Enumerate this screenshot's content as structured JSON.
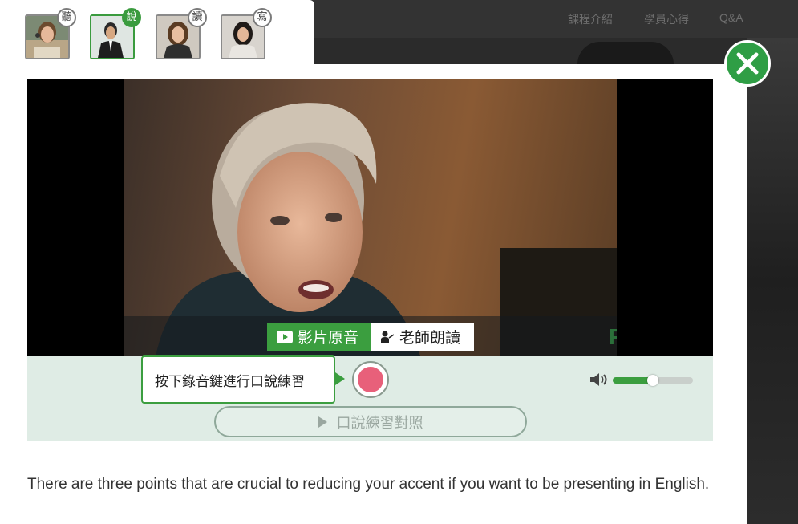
{
  "background_nav": {
    "items": [
      "課程介紹",
      "學員心得",
      "Q&A"
    ]
  },
  "skill_tabs": [
    {
      "badge": "聽",
      "active": false
    },
    {
      "badge": "說",
      "active": true
    },
    {
      "badge": "讀",
      "active": false
    },
    {
      "badge": "寫",
      "active": false
    }
  ],
  "video": {
    "watermark": "PODIUM",
    "mode_original_label": "影片原音",
    "mode_teacher_label": "老師朗讀",
    "selected_mode": "影片原音"
  },
  "recorder": {
    "hint": "按下錄音鍵進行口說練習",
    "volume_level": 0.5,
    "compare_label": "口說練習對照"
  },
  "transcript": "There are three points that are crucial to reducing your accent if you want to be presenting in English.",
  "colors": {
    "accent_green": "#3b9e3f",
    "record_red": "#e8607a",
    "recorder_bg": "#dfece5"
  }
}
